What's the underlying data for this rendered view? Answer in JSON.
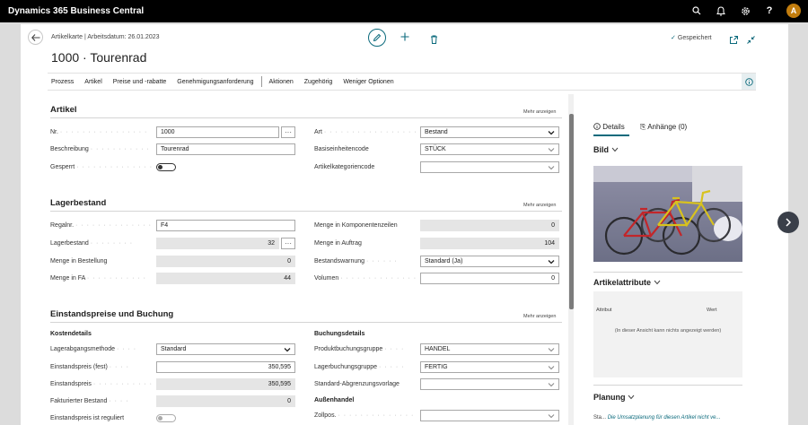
{
  "app": {
    "title": "Dynamics 365 Business Central",
    "avatar_initial": "A"
  },
  "header": {
    "breadcrumb": "Artikelkarte | Arbeitsdatum: 26.01.2023",
    "title": "1000 · Tourenrad",
    "saved_label": "Gespeichert"
  },
  "actions": [
    "Prozess",
    "Artikel",
    "Preise und -rabatte",
    "Genehmigungsanforderung",
    "Aktionen",
    "Zugehörig",
    "Weniger Optionen"
  ],
  "sections": {
    "artikel": {
      "title": "Artikel",
      "more": "Mehr anzeigen",
      "nr_label": "Nr.",
      "nr_value": "1000",
      "beschreibung_label": "Beschreibung",
      "beschreibung_value": "Tourenrad",
      "gesperrt_label": "Gesperrt",
      "art_label": "Art",
      "art_value": "Bestand",
      "basiseinheit_label": "Basiseinheitencode",
      "basiseinheit_value": "STÜCK",
      "kategorie_label": "Artikelkategoriencode",
      "kategorie_value": ""
    },
    "lager": {
      "title": "Lagerbestand",
      "more": "Mehr anzeigen",
      "regalnr_label": "Regalnr.",
      "regalnr_value": "F4",
      "lagerbestand_label": "Lagerbestand",
      "lagerbestand_value": "32",
      "bestellung_label": "Menge in Bestellung",
      "bestellung_value": "0",
      "fa_label": "Menge in FA",
      "fa_value": "44",
      "komponenten_label": "Menge in Komponentenzeilen",
      "komponenten_value": "0",
      "auftrag_label": "Menge in Auftrag",
      "auftrag_value": "104",
      "warnung_label": "Bestandswarnung",
      "warnung_value": "Standard (Ja)",
      "volumen_label": "Volumen",
      "volumen_value": "0"
    },
    "preise": {
      "title": "Einstandspreise und Buchung",
      "more": "Mehr anzeigen",
      "kosten_header": "Kostendetails",
      "methode_label": "Lagerabgangsmethode",
      "methode_value": "Standard",
      "fest_label": "Einstandspreis (fest)",
      "fest_value": "350,595",
      "einstand_label": "Einstandspreis",
      "einstand_value": "350,595",
      "fakturiert_label": "Fakturierter Bestand",
      "fakturiert_value": "0",
      "reguliert_label": "Einstandspreis ist reguliert",
      "buchung_header": "Buchungsdetails",
      "produkt_label": "Produktbuchungsgruppe",
      "produkt_value": "HANDEL",
      "lagerbuchung_label": "Lagerbuchungsgruppe",
      "lagerbuchung_value": "FERTIG",
      "abgrenzung_label": "Standard-Abgrenzungsvorlage",
      "abgrenzung_value": "",
      "aussen_header": "Außenhandel",
      "zollpos_label": "Zollpos.",
      "zollpos_value": ""
    }
  },
  "factbox": {
    "tab_details": "Details",
    "tab_anhaenge": "Anhänge (0)",
    "bild_title": "Bild",
    "attribute_title": "Artikelattribute",
    "attr_col1": "Attribut",
    "attr_col2": "Wert",
    "attr_empty": "(In dieser Ansicht kann nichts angezeigt werden)",
    "planung_title": "Planung",
    "planung_prefix": "Sta...",
    "planung_link": "Die Umsatzplanung für diesen Artikel nicht ve..."
  }
}
